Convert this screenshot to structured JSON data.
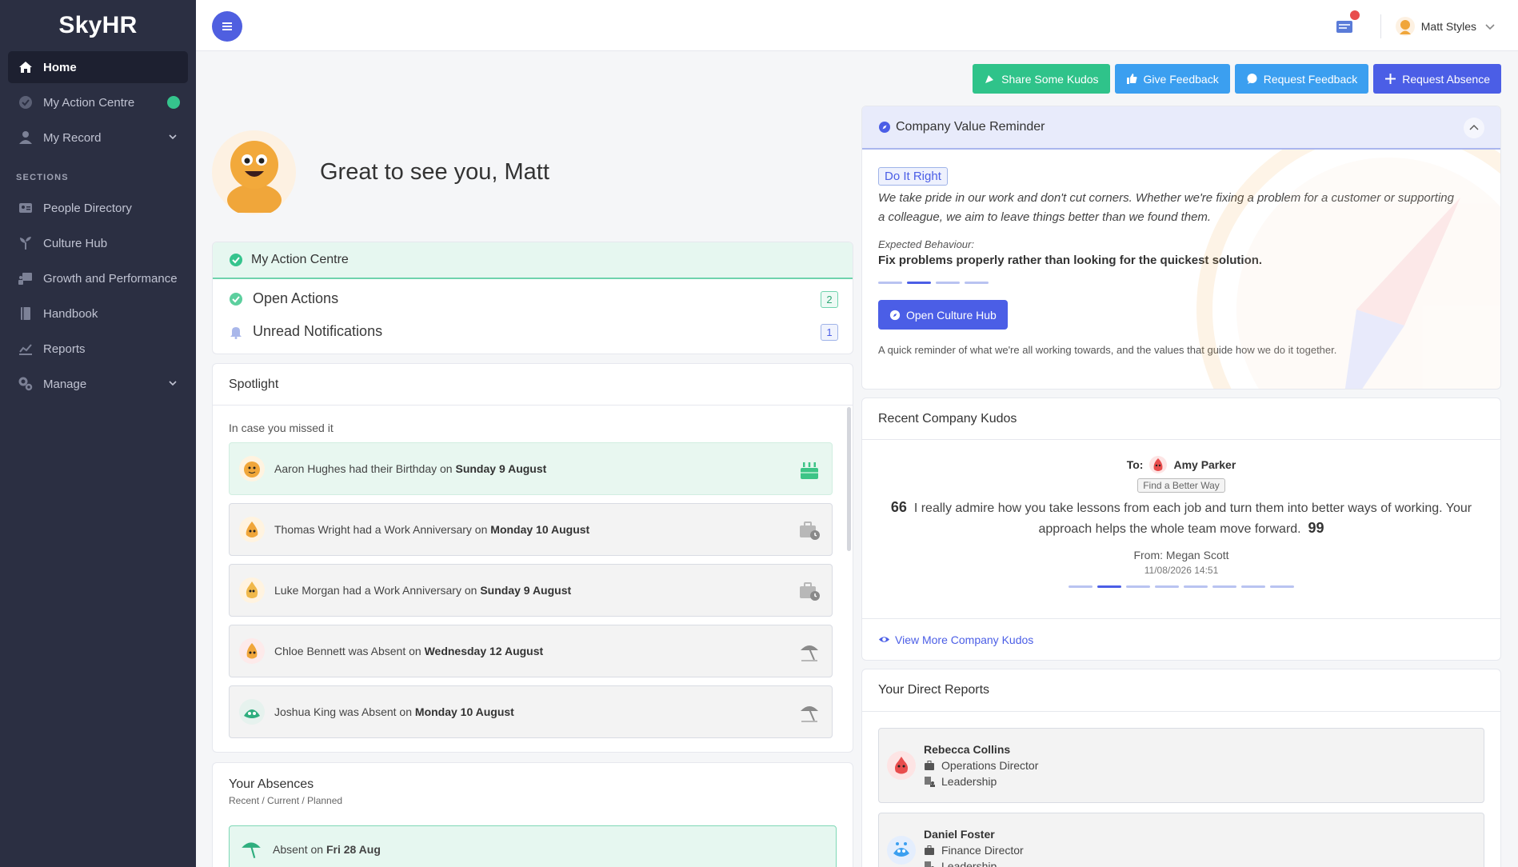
{
  "app": {
    "brand": "SkyHR"
  },
  "sidebar": {
    "items": [
      {
        "label": "Home",
        "icon": "home-icon",
        "active": true
      },
      {
        "label": "My Action Centre",
        "icon": "check-circle-icon"
      },
      {
        "label": "My Record",
        "icon": "user-icon"
      }
    ],
    "section_title": "SECTIONS",
    "section_items": [
      {
        "label": "People Directory",
        "icon": "id-card-icon"
      },
      {
        "label": "Culture Hub",
        "icon": "plant-icon"
      },
      {
        "label": "Growth and Performance",
        "icon": "presentation-icon"
      },
      {
        "label": "Handbook",
        "icon": "book-icon"
      },
      {
        "label": "Reports",
        "icon": "chart-icon"
      },
      {
        "label": "Manage",
        "icon": "gears-icon"
      }
    ]
  },
  "topbar": {
    "user_name": "Matt Styles"
  },
  "actions": {
    "share_kudos": "Share Some Kudos",
    "give_feedback": "Give Feedback",
    "request_feedback": "Request Feedback",
    "request_absence": "Request Absence"
  },
  "greeting": "Great to see you, Matt",
  "action_centre": {
    "title": "My Action Centre",
    "open_actions": {
      "label": "Open Actions",
      "count": "2"
    },
    "unread": {
      "label": "Unread Notifications",
      "count": "1"
    }
  },
  "spotlight": {
    "title": "Spotlight",
    "subtitle": "In case you missed it",
    "items": [
      {
        "text": "Aaron Hughes had their Birthday on ",
        "bold": "Sunday 9 August"
      },
      {
        "text": "Thomas Wright had a Work Anniversary on ",
        "bold": "Monday 10 August"
      },
      {
        "text": "Luke Morgan had a Work Anniversary on ",
        "bold": "Sunday 9 August"
      },
      {
        "text": "Chloe Bennett was Absent on ",
        "bold": "Wednesday 12 August"
      },
      {
        "text": "Joshua King was Absent on ",
        "bold": "Monday 10 August"
      }
    ]
  },
  "absences": {
    "title": "Your Absences",
    "subtitle": "Recent / Current / Planned",
    "item_text": "Absent on ",
    "item_bold": "Fri 28 Aug"
  },
  "company_value": {
    "title": "Company Value Reminder",
    "tag": "Do It Right",
    "text": "We take pride in our work and don't cut corners. Whether we're fixing a problem for a customer or supporting a colleague, we aim to leave things better than we found them.",
    "expected_label": "Expected Behaviour:",
    "expected": "Fix problems properly rather than looking for the quickest solution.",
    "button": "Open Culture Hub",
    "footer": "A quick reminder of what we're all working towards, and the values that guide how we do it together."
  },
  "kudos": {
    "title": "Recent Company Kudos",
    "to_label": "To:",
    "to_name": "Amy Parker",
    "tag": "Find a Better Way",
    "open_quote": "66",
    "quote": "I really admire how you take lessons from each job and turn them into better ways of working. Your approach helps the whole team move forward.",
    "close_quote": "99",
    "from": "From: Megan Scott",
    "date": "11/08/2026 14:51",
    "view_more": "View More Company Kudos"
  },
  "direct_reports": {
    "title": "Your Direct Reports",
    "items": [
      {
        "name": "Rebecca Collins",
        "role": "Operations Director",
        "team": "Leadership"
      },
      {
        "name": "Daniel Foster",
        "role": "Finance Director",
        "team": "Leadership"
      }
    ]
  },
  "colors": {
    "sidebar_bg": "#2b2f42",
    "primary": "#4b5ee6",
    "success": "#2fc38a",
    "info": "#3b9ff0"
  }
}
